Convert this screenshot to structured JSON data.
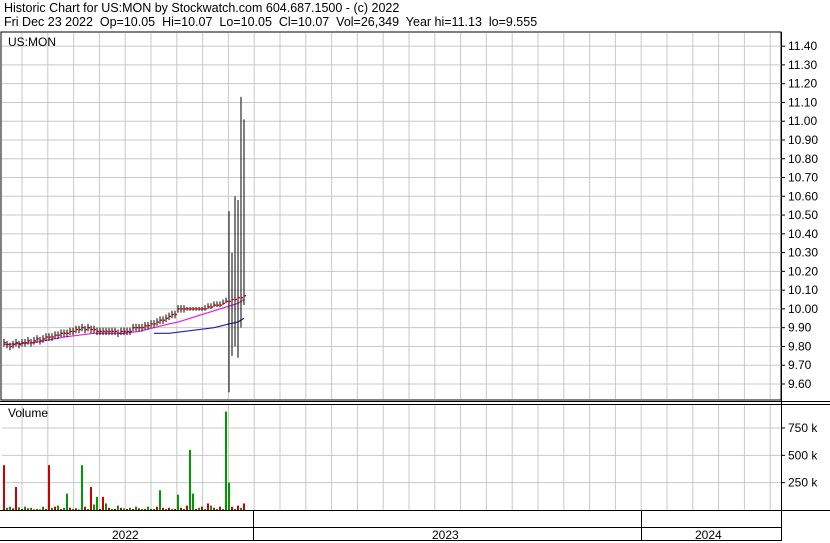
{
  "header": {
    "line1": "Historic Chart for US:MON by Stockwatch.com 604.687.1500 - (c) 2022",
    "line2": "Fri Dec 23 2022  Op=10.05  Hi=10.07  Lo=10.05  Cl=10.07  Vol=26,349  Year hi=11.13  lo=9.555"
  },
  "chart_data": [
    {
      "type": "line",
      "title": "US:MON",
      "ylim": [
        9.52,
        11.47
      ],
      "yticks": [
        "11.40",
        "11.30",
        "11.20",
        "11.10",
        "11.00",
        "10.90",
        "10.80",
        "10.70",
        "10.60",
        "10.50",
        "10.40",
        "10.30",
        "10.20",
        "10.10",
        "10.00",
        "9.90",
        "9.80",
        "9.70",
        "9.60"
      ],
      "grid": true,
      "series": [
        {
          "color": "#000000",
          "description": "daily price bars (high/low) with red closes",
          "x": [
            0,
            1,
            2,
            3,
            4,
            5,
            6,
            7,
            8,
            9,
            10,
            11,
            12,
            13,
            14,
            15,
            16,
            17,
            18,
            19,
            20,
            21,
            22,
            23,
            24,
            25,
            26,
            27,
            28,
            29,
            30,
            31,
            32,
            33,
            34,
            35,
            36,
            37,
            38,
            39,
            40,
            41,
            42,
            43,
            44,
            45,
            46,
            47,
            48,
            49,
            50,
            51,
            52,
            53,
            54,
            55,
            56,
            57,
            58,
            59,
            60,
            61,
            62,
            63,
            64,
            65,
            66,
            67,
            68,
            69,
            70,
            71,
            72,
            73,
            74,
            75,
            76,
            77,
            78,
            79,
            80
          ],
          "close": [
            9.82,
            9.81,
            9.8,
            9.81,
            9.82,
            9.81,
            9.82,
            9.82,
            9.83,
            9.82,
            9.83,
            9.84,
            9.83,
            9.84,
            9.85,
            9.85,
            9.85,
            9.86,
            9.86,
            9.87,
            9.87,
            9.87,
            9.88,
            9.88,
            9.89,
            9.89,
            9.9,
            9.89,
            9.9,
            9.89,
            9.89,
            9.88,
            9.88,
            9.88,
            9.88,
            9.88,
            9.88,
            9.88,
            9.87,
            9.88,
            9.88,
            9.88,
            9.88,
            9.9,
            9.9,
            9.9,
            9.9,
            9.91,
            9.91,
            9.92,
            9.92,
            9.93,
            9.94,
            9.94,
            9.95,
            9.96,
            9.97,
            9.97,
            10.0,
            10.0,
            10.0,
            10.0,
            10.0,
            10.0,
            10.0,
            10.0,
            10.0,
            10.0,
            10.01,
            10.01,
            10.02,
            10.02,
            10.02,
            10.03,
            10.04,
            10.04,
            10.05,
            10.05,
            10.06,
            10.06,
            10.07
          ],
          "high": [
            9.84,
            9.83,
            9.82,
            9.83,
            9.84,
            9.83,
            9.84,
            9.84,
            9.85,
            9.84,
            9.85,
            9.86,
            9.85,
            9.86,
            9.87,
            9.87,
            9.87,
            9.88,
            9.88,
            9.89,
            9.89,
            9.89,
            9.9,
            9.9,
            9.91,
            9.91,
            9.92,
            9.91,
            9.92,
            9.91,
            9.91,
            9.9,
            9.9,
            9.9,
            9.9,
            9.9,
            9.9,
            9.9,
            9.89,
            9.9,
            9.9,
            9.9,
            9.9,
            9.92,
            9.92,
            9.92,
            9.92,
            9.93,
            9.93,
            9.94,
            9.94,
            9.95,
            9.96,
            9.96,
            9.97,
            9.98,
            9.99,
            9.99,
            10.02,
            10.02,
            10.02,
            10.01,
            10.01,
            10.01,
            10.01,
            10.01,
            10.01,
            10.02,
            10.03,
            10.03,
            10.04,
            10.04,
            10.04,
            10.05,
            10.06,
            10.52,
            10.3,
            10.6,
            10.58,
            11.13,
            11.01
          ],
          "low": [
            9.8,
            9.79,
            9.78,
            9.79,
            9.8,
            9.79,
            9.8,
            9.8,
            9.81,
            9.8,
            9.81,
            9.82,
            9.81,
            9.82,
            9.83,
            9.83,
            9.83,
            9.84,
            9.84,
            9.85,
            9.85,
            9.85,
            9.86,
            9.86,
            9.87,
            9.87,
            9.88,
            9.87,
            9.88,
            9.87,
            9.87,
            9.86,
            9.86,
            9.86,
            9.86,
            9.86,
            9.86,
            9.86,
            9.85,
            9.86,
            9.86,
            9.86,
            9.86,
            9.88,
            9.88,
            9.88,
            9.88,
            9.89,
            9.89,
            9.9,
            9.9,
            9.91,
            9.92,
            9.92,
            9.93,
            9.94,
            9.95,
            9.95,
            9.98,
            9.98,
            9.98,
            9.99,
            9.99,
            9.99,
            9.99,
            9.99,
            9.99,
            9.99,
            10.0,
            10.0,
            10.01,
            10.01,
            10.01,
            10.02,
            10.03,
            9.555,
            9.75,
            9.8,
            9.74,
            9.9,
            10.02
          ]
        },
        {
          "color": "#e020e0",
          "description": "moving average",
          "x": [
            0,
            10,
            20,
            30,
            40,
            45,
            50,
            55,
            58,
            62,
            66,
            70,
            74,
            78,
            80
          ],
          "y": [
            9.81,
            9.82,
            9.85,
            9.87,
            9.87,
            9.88,
            9.9,
            9.92,
            9.93,
            9.95,
            9.97,
            9.99,
            10.01,
            10.03,
            10.05
          ]
        },
        {
          "color": "#2020b0",
          "description": "moving average",
          "x": [
            50,
            55,
            60,
            65,
            70,
            75,
            78,
            80
          ],
          "y": [
            9.87,
            9.87,
            9.88,
            9.89,
            9.9,
            9.92,
            9.93,
            9.95
          ]
        }
      ]
    },
    {
      "type": "bar",
      "title": "Volume",
      "ylim": [
        0,
        960000
      ],
      "yticks": [
        "750 k",
        "500 k",
        "250 k"
      ],
      "grid": true,
      "x": [
        0,
        1,
        2,
        3,
        4,
        5,
        6,
        7,
        8,
        9,
        10,
        11,
        12,
        13,
        14,
        15,
        16,
        17,
        18,
        19,
        20,
        21,
        22,
        23,
        24,
        25,
        26,
        27,
        28,
        29,
        30,
        31,
        32,
        33,
        34,
        35,
        36,
        37,
        38,
        39,
        40,
        41,
        42,
        43,
        44,
        45,
        46,
        47,
        48,
        49,
        50,
        51,
        52,
        53,
        54,
        55,
        56,
        57,
        58,
        59,
        60,
        61,
        62,
        63,
        64,
        65,
        66,
        67,
        68,
        69,
        70,
        71,
        72,
        73,
        74,
        75,
        76,
        77,
        78,
        79,
        80
      ],
      "values": [
        410000,
        20000,
        30000,
        15000,
        210000,
        25000,
        10000,
        30000,
        15000,
        20000,
        5000,
        10000,
        5000,
        30000,
        10000,
        410000,
        20000,
        30000,
        40000,
        10000,
        20000,
        150000,
        20000,
        10000,
        15000,
        5000,
        410000,
        30000,
        10000,
        210000,
        50000,
        120000,
        10000,
        120000,
        60000,
        20000,
        10000,
        10000,
        40000,
        20000,
        15000,
        10000,
        20000,
        10000,
        30000,
        15000,
        10000,
        10000,
        30000,
        10000,
        10000,
        30000,
        180000,
        20000,
        10000,
        20000,
        10000,
        10000,
        140000,
        20000,
        10000,
        40000,
        550000,
        150000,
        10000,
        20000,
        30000,
        10000,
        60000,
        40000,
        20000,
        10000,
        30000,
        10000,
        900000,
        250000,
        30000,
        10000,
        40000,
        20000,
        60000
      ],
      "colors": [
        "#cc0000",
        "#009900",
        "#009900",
        "#cc0000",
        "#cc0000",
        "#009900",
        "#cc0000",
        "#009900",
        "#cc0000",
        "#009900",
        "#cc0000",
        "#009900",
        "#cc0000",
        "#009900",
        "#cc0000",
        "#cc0000",
        "#009900",
        "#cc0000",
        "#009900",
        "#cc0000",
        "#009900",
        "#009900",
        "#cc0000",
        "#009900",
        "#cc0000",
        "#009900",
        "#009900",
        "#cc0000",
        "#009900",
        "#cc0000",
        "#009900",
        "#009900",
        "#cc0000",
        "#cc0000",
        "#009900",
        "#cc0000",
        "#009900",
        "#cc0000",
        "#009900",
        "#cc0000",
        "#009900",
        "#cc0000",
        "#009900",
        "#cc0000",
        "#009900",
        "#cc0000",
        "#009900",
        "#cc0000",
        "#009900",
        "#cc0000",
        "#009900",
        "#cc0000",
        "#009900",
        "#cc0000",
        "#009900",
        "#cc0000",
        "#009900",
        "#cc0000",
        "#009900",
        "#cc0000",
        "#009900",
        "#cc0000",
        "#009900",
        "#009900",
        "#cc0000",
        "#009900",
        "#cc0000",
        "#009900",
        "#cc0000",
        "#009900",
        "#cc0000",
        "#009900",
        "#cc0000",
        "#009900",
        "#009900",
        "#009900",
        "#cc0000",
        "#009900",
        "#cc0000",
        "#009900",
        "#cc0000"
      ]
    }
  ],
  "x_axis": {
    "years": [
      "2022",
      "2023",
      "2024"
    ]
  }
}
